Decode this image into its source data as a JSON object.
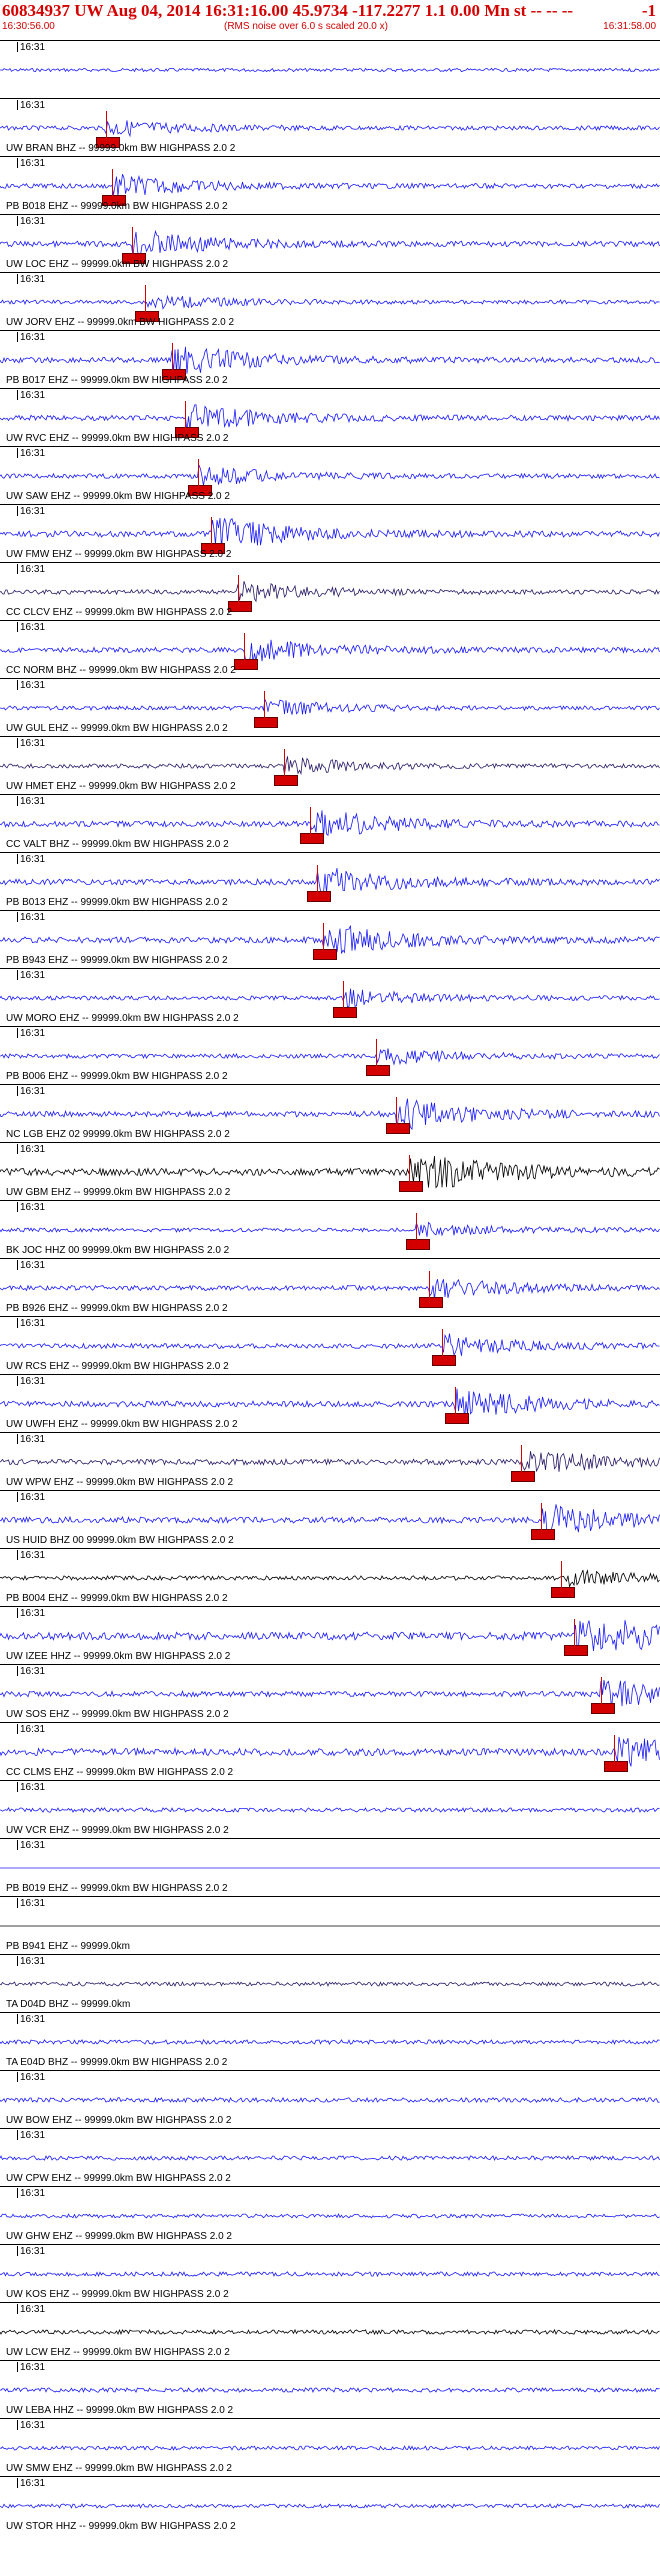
{
  "header": {
    "title": "60834937 UW Aug 04, 2014 16:31:16.00   45.9734 -117.2277  1.1 0.00 Mn st -- -- --",
    "title_right": "-1",
    "start_time": "16:30:56.00",
    "end_time": "16:31:58.00",
    "note": "(RMS noise over 6.0 s scaled 20.0 x)",
    "tick": "16:31"
  },
  "colors": {
    "blue": "#1a1aff",
    "black": "#000000",
    "dark": "#2a1a66",
    "red": "#d40000"
  },
  "traces": [
    {
      "label": "",
      "color": "#1a1aff",
      "amp": 0.15,
      "pick": null
    },
    {
      "label": "UW BRAN BHZ -- 99999.0km BW  HIGHPASS  2.0  2",
      "color": "#1a1aff",
      "amp": 0.3,
      "pick": 0.16
    },
    {
      "label": "PB B018 EHZ -- 99999.0km BW  HIGHPASS  2.0  2",
      "color": "#1a1aff",
      "amp": 0.4,
      "pick": 0.17
    },
    {
      "label": "UW LOC EHZ -- 99999.0km BW  HIGHPASS  2.0  2",
      "color": "#1a1aff",
      "amp": 0.5,
      "pick": 0.2
    },
    {
      "label": "UW JORV EHZ -- 99999.0km BW  HIGHPASS  2.0  2",
      "color": "#1a1aff",
      "amp": 0.25,
      "pick": 0.22
    },
    {
      "label": "PB B017 EHZ -- 99999.0km BW  HIGHPASS  2.0  2",
      "color": "#1a1aff",
      "amp": 0.55,
      "pick": 0.26
    },
    {
      "label": "UW RVC EHZ -- 99999.0km BW  HIGHPASS  2.0  2",
      "color": "#1a1aff",
      "amp": 0.5,
      "pick": 0.28
    },
    {
      "label": "UW SAW EHZ -- 99999.0km BW  HIGHPASS  2.0  2",
      "color": "#1a1aff",
      "amp": 0.35,
      "pick": 0.3
    },
    {
      "label": "UW FMW EHZ -- 99999.0km BW  HIGHPASS  2.0  2",
      "color": "#1a1aff",
      "amp": 0.6,
      "pick": 0.32
    },
    {
      "label": "CC CLCV EHZ -- 99999.0km BW  HIGHPASS  2.0  2",
      "color": "#2a1a66",
      "amp": 0.35,
      "pick": 0.36
    },
    {
      "label": "CC NORM BHZ -- 99999.0km BW  HIGHPASS  2.0  2",
      "color": "#1a1aff",
      "amp": 0.45,
      "pick": 0.37
    },
    {
      "label": "UW GUL EHZ -- 99999.0km BW  HIGHPASS  2.0  2",
      "color": "#1a1aff",
      "amp": 0.3,
      "pick": 0.4
    },
    {
      "label": "UW HMET EHZ -- 99999.0km BW  HIGHPASS  2.0  2",
      "color": "#2a1a66",
      "amp": 0.3,
      "pick": 0.43
    },
    {
      "label": "CC VALT BHZ -- 99999.0km BW  HIGHPASS  2.0  2",
      "color": "#1a1aff",
      "amp": 0.55,
      "pick": 0.47
    },
    {
      "label": "PB B013 EHZ -- 99999.0km BW  HIGHPASS  2.0  2",
      "color": "#1a1aff",
      "amp": 0.55,
      "pick": 0.48
    },
    {
      "label": "PB B943 EHZ -- 99999.0km BW  HIGHPASS  2.0  2",
      "color": "#1a1aff",
      "amp": 0.6,
      "pick": 0.49
    },
    {
      "label": "UW MORO EHZ -- 99999.0km BW  HIGHPASS  2.0  2",
      "color": "#1a1aff",
      "amp": 0.3,
      "pick": 0.52
    },
    {
      "label": "PB B006 EHZ -- 99999.0km BW  HIGHPASS  2.0  2",
      "color": "#1a1aff",
      "amp": 0.3,
      "pick": 0.57
    },
    {
      "label": "NC LGB EHZ 02 99999.0km BW  HIGHPASS  2.0  2",
      "color": "#1a1aff",
      "amp": 0.55,
      "pick": 0.6
    },
    {
      "label": "UW GBM EHZ -- 99999.0km BW  HIGHPASS  2.0  2",
      "color": "#000000",
      "amp": 0.8,
      "pick": 0.62
    },
    {
      "label": "BK JOC HHZ 00 99999.0km BW  HIGHPASS  2.0  2",
      "color": "#1a1aff",
      "amp": 0.25,
      "pick": 0.63
    },
    {
      "label": "PB B926 EHZ -- 99999.0km BW  HIGHPASS  2.0  2",
      "color": "#1a1aff",
      "amp": 0.4,
      "pick": 0.65
    },
    {
      "label": "UW RCS EHZ -- 99999.0km BW  HIGHPASS  2.0  2",
      "color": "#1a1aff",
      "amp": 0.4,
      "pick": 0.67
    },
    {
      "label": "UW UWFH EHZ -- 99999.0km BW  HIGHPASS  2.0  2",
      "color": "#1a1aff",
      "amp": 0.55,
      "pick": 0.69
    },
    {
      "label": "UW WPW EHZ -- 99999.0km BW  HIGHPASS  2.0  2",
      "color": "#2a1a66",
      "amp": 0.5,
      "pick": 0.79
    },
    {
      "label": "US HUID BHZ 00 99999.0km BW  HIGHPASS  2.0  2",
      "color": "#1a1aff",
      "amp": 0.6,
      "pick": 0.82
    },
    {
      "label": "PB B004 EHZ -- 99999.0km BW  HIGHPASS  2.0  2",
      "color": "#000000",
      "amp": 0.3,
      "pick": 0.85
    },
    {
      "label": "UW IZEE HHZ -- 99999.0km BW  HIGHPASS  2.0  2",
      "color": "#1a1aff",
      "amp": 0.9,
      "pick": 0.87
    },
    {
      "label": "UW SOS EHZ -- 99999.0km BW  HIGHPASS  2.0  2",
      "color": "#1a1aff",
      "amp": 0.5,
      "pick": 0.91
    },
    {
      "label": "CC CLMS EHZ -- 99999.0km BW  HIGHPASS  2.0  2",
      "color": "#1a1aff",
      "amp": 0.8,
      "pick": 0.93
    },
    {
      "label": "UW VCR EHZ -- 99999.0km BW  HIGHPASS  2.0  2",
      "color": "#1a1aff",
      "amp": 0.3,
      "pick": null
    },
    {
      "label": "PB B019 EHZ -- 99999.0km BW  HIGHPASS  2.0  2",
      "color": "#1a1aff",
      "amp": 0.0,
      "pick": null
    },
    {
      "label": "PB B941 EHZ -- 99999.0km",
      "color": "#000000",
      "amp": 0.0,
      "pick": null
    },
    {
      "label": "TA D04D BHZ -- 99999.0km",
      "color": "#2a1a66",
      "amp": 0.25,
      "pick": null
    },
    {
      "label": "TA E04D BHZ -- 99999.0km BW  HIGHPASS  2.0  2",
      "color": "#1a1aff",
      "amp": 0.3,
      "pick": null
    },
    {
      "label": "UW BOW EHZ -- 99999.0km BW  HIGHPASS  2.0  2",
      "color": "#1a1aff",
      "amp": 0.35,
      "pick": null
    },
    {
      "label": "UW CPW EHZ -- 99999.0km BW  HIGHPASS  2.0  2",
      "color": "#1a1aff",
      "amp": 0.3,
      "pick": null
    },
    {
      "label": "UW GHW EHZ -- 99999.0km BW  HIGHPASS  2.0  2",
      "color": "#1a1aff",
      "amp": 0.25,
      "pick": null
    },
    {
      "label": "UW KOS EHZ -- 99999.0km BW  HIGHPASS  2.0  2",
      "color": "#1a1aff",
      "amp": 0.3,
      "pick": null
    },
    {
      "label": "UW LCW EHZ -- 99999.0km BW  HIGHPASS  2.0  2",
      "color": "#000000",
      "amp": 0.3,
      "pick": null
    },
    {
      "label": "UW LEBA HHZ -- 99999.0km BW  HIGHPASS  2.0  2",
      "color": "#1a1aff",
      "amp": 0.3,
      "pick": null
    },
    {
      "label": "UW SMW EHZ -- 99999.0km BW  HIGHPASS  2.0  2",
      "color": "#1a1aff",
      "amp": 0.25,
      "pick": null
    },
    {
      "label": "UW STOR HHZ -- 99999.0km BW  HIGHPASS  2.0  2",
      "color": "#1a1aff",
      "amp": 0.25,
      "pick": null
    }
  ]
}
